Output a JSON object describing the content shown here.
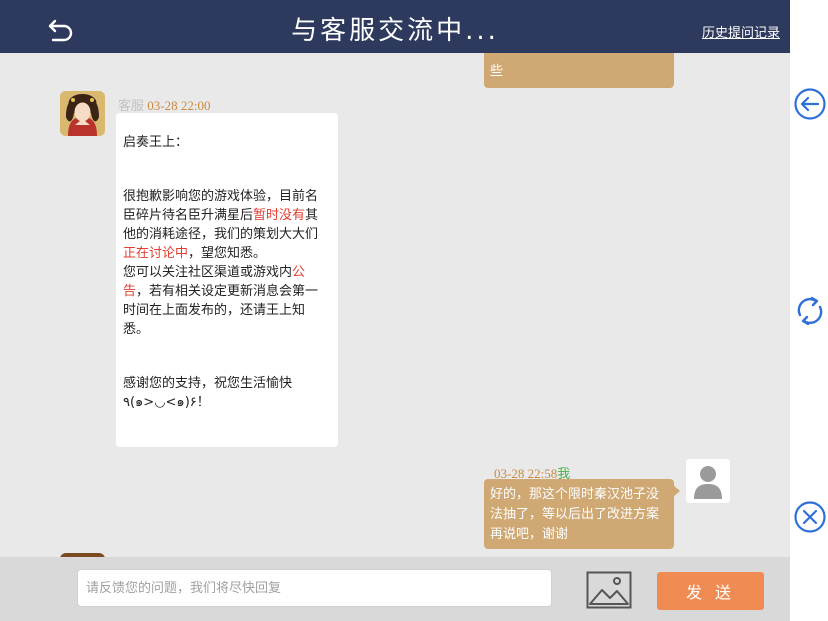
{
  "header": {
    "title": "与客服交流中...",
    "history_link": "历史提问记录"
  },
  "chat": {
    "previous_bubble_text": "些",
    "agent_message": {
      "name": "客服",
      "time": "03-28 22:00",
      "greeting": "启奏王上：",
      "para1_a": "很抱歉影响您的游戏体验，目前名臣碎片待名臣升满星后",
      "para1_red1": "暂时没有",
      "para1_b": "其他的消耗途径，我们的策划大大们",
      "para1_red2": "正在讨论中",
      "para1_c": "，望您知悉。",
      "para2_a": "您可以关注社区渠道或游戏内",
      "para2_red": "公告",
      "para2_b": "，若有相关设定更新消息会第一时间在上面发布的，还请王上知悉。",
      "closing": "感谢您的支持，祝您生活愉快",
      "emoticon": "٩(๑>◡<๑)۶！"
    },
    "user_message": {
      "time": "03-28 22:58",
      "name": "我",
      "text": "好的，那这个限时秦汉池子没法抽了，等以后出了改进方案再说吧，谢谢"
    }
  },
  "footer": {
    "input_placeholder": "请反馈您的问题，我们将尽快回复",
    "send_label": "发 送"
  },
  "icons": {
    "back": "back-arrow-icon",
    "image": "image-icon",
    "side_back": "circle-arrow-left-icon",
    "refresh": "refresh-icon",
    "close": "circle-close-icon"
  },
  "colors": {
    "header_bg": "#2d3a5e",
    "bubble": "#cfa873",
    "send_button": "#ef8b53",
    "accent_blue": "#2f6fd8",
    "highlight_red": "#e23d2f",
    "me_green": "#46b04b"
  }
}
